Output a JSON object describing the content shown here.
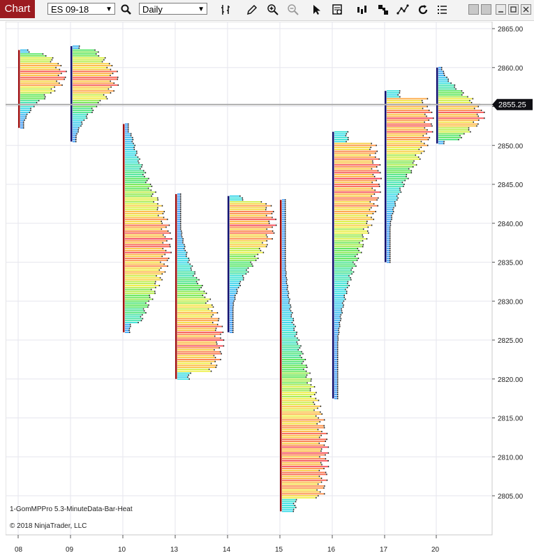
{
  "toolbar": {
    "chart_tab": "Chart",
    "instrument": "ES 09-18",
    "period": "Daily"
  },
  "chart": {
    "indicator_label": "1-GomMPPro 5.3-MinuteData-Bar-Heat",
    "copyright": "© 2018 NinjaTrader, LLC",
    "current_price": "2855.25"
  },
  "chart_data": {
    "type": "bar",
    "title": "",
    "y_ticks": [
      "2865.00",
      "2860.00",
      "2855.00",
      "2850.00",
      "2845.00",
      "2840.00",
      "2835.00",
      "2830.00",
      "2825.00",
      "2820.00",
      "2815.00",
      "2810.00",
      "2805.00"
    ],
    "x_ticks": [
      "08",
      "09",
      "10",
      "13",
      "14",
      "15",
      "16",
      "17",
      "20"
    ],
    "ylim": [
      2803,
      2866
    ],
    "last_price": 2855.25,
    "days": [
      {
        "date": "08",
        "high": 2862.25,
        "low": 2852.25,
        "poc": 2859.0,
        "max": 2862,
        "candle_color": "#a01010"
      },
      {
        "date": "09",
        "high": 2862.75,
        "low": 2850.5,
        "poc": 2858.5,
        "max": 2860,
        "candle_color": "#101070"
      },
      {
        "date": "10",
        "high": 2852.75,
        "low": 2826.0,
        "poc": 2837.5,
        "max": 2839,
        "candle_color": "#a01010"
      },
      {
        "date": "13",
        "high": 2843.75,
        "low": 2820.0,
        "poc": 2825.0,
        "max": 2826,
        "candle_color": "#a01010"
      },
      {
        "date": "14",
        "high": 2843.5,
        "low": 2826.0,
        "poc": 2840.0,
        "max": 2841,
        "candle_color": "#101070"
      },
      {
        "date": "15",
        "high": 2843.0,
        "low": 2803.0,
        "poc": 2810.0,
        "max": 2811,
        "candle_color": "#a01010"
      },
      {
        "date": "16",
        "high": 2851.75,
        "low": 2817.5,
        "poc": 2845.75,
        "max": 2847,
        "candle_color": "#101070"
      },
      {
        "date": "17",
        "high": 2857.0,
        "low": 2835.0,
        "poc": 2853.0,
        "max": 2854,
        "candle_color": "#101070"
      },
      {
        "date": "20",
        "high": 2860.0,
        "low": 2850.25,
        "poc": 2854.0,
        "max": 2856,
        "candle_color": "#101070"
      }
    ]
  }
}
